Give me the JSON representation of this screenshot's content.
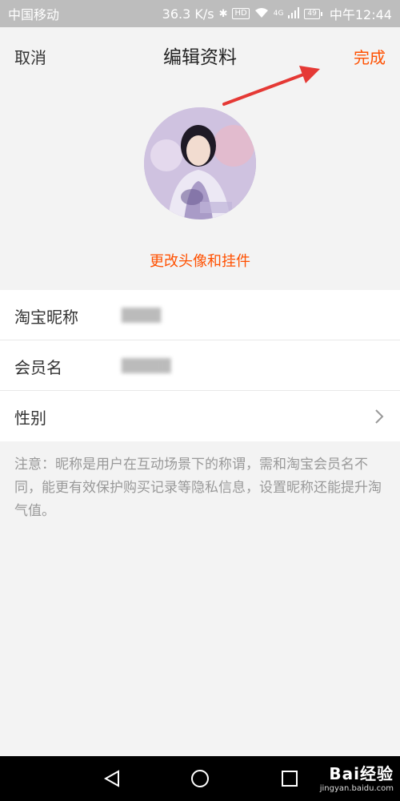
{
  "status_bar": {
    "carrier": "中国移动",
    "speed": "36.3 K/s",
    "network_badge": "HD",
    "signal_label": "4G",
    "battery": "49",
    "time": "中午12:44"
  },
  "header": {
    "cancel_label": "取消",
    "title": "编辑资料",
    "done_label": "完成"
  },
  "avatar": {
    "change_label": "更改头像和挂件"
  },
  "form": {
    "rows": [
      {
        "label": "淘宝昵称",
        "value": "████"
      },
      {
        "label": "会员名",
        "value": "█████"
      },
      {
        "label": "性别",
        "value": ""
      }
    ]
  },
  "note": "注意：昵称是用户在互动场景下的称谓，需和淘宝会员名不同，能更有效保护购买记录等隐私信息，设置昵称还能提升淘气值。",
  "watermark": {
    "brand": "Bai经验",
    "url": "jingyan.baidu.com"
  },
  "colors": {
    "accent": "#ff5000",
    "annotation_arrow": "#e53935"
  }
}
